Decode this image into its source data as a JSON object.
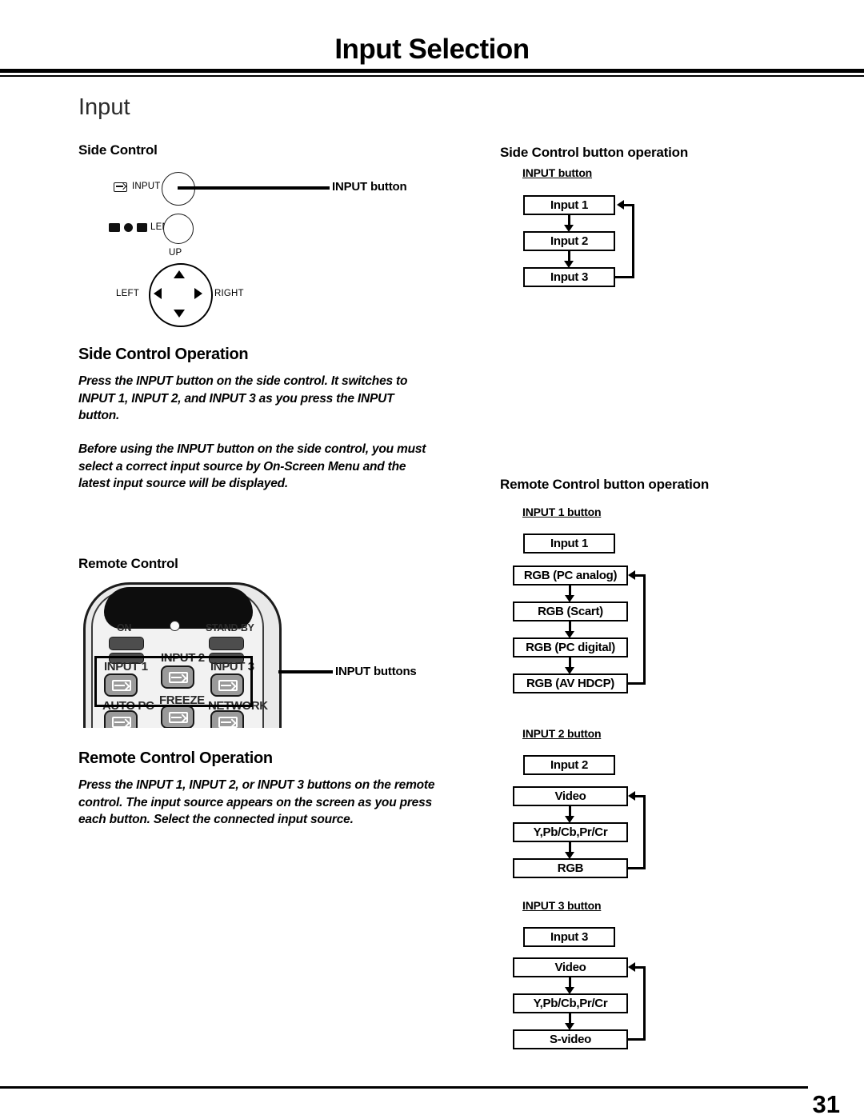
{
  "header": {
    "title": "Input Selection"
  },
  "section": {
    "heading": "Input"
  },
  "left_column": {
    "side_control_heading": "Side Control",
    "side_control_diagram": {
      "input_label": "INPUT",
      "lens_label": "LENS",
      "up_label": "UP",
      "left_label": "LEFT",
      "right_label": "RIGHT",
      "callout": "INPUT button"
    },
    "side_control_operation": {
      "heading": "Side Control Operation",
      "paragraph_1": "Press the INPUT button on the side control. It switches to INPUT 1, INPUT 2, and INPUT 3 as you press the INPUT button.",
      "paragraph_2": "Before using the INPUT button on the side control, you must select a correct input source by On-Screen Menu and the latest input source will be displayed."
    },
    "remote_control_heading": "Remote Control",
    "remote_diagram": {
      "on_label": "ON",
      "standby_label": "STAND-BY",
      "input1_label": "INPUT 1",
      "input2_label": "INPUT 2",
      "input3_label": "INPUT 3",
      "autopc_label": "AUTO PC",
      "freeze_label": "FREEZE",
      "network_label": "NETWORK",
      "callout": "INPUT buttons"
    },
    "remote_control_operation": {
      "heading": "Remote Control Operation",
      "paragraph_1": "Press the INPUT 1, INPUT 2, or INPUT 3 buttons on the remote control. The input source appears on the screen as you press each button. Select the connected input source."
    }
  },
  "right_column": {
    "side_control_button_operation": {
      "heading": "Side Control button operation",
      "sub_heading": "INPUT button",
      "boxes": [
        "Input 1",
        "Input 2",
        "Input 3"
      ]
    },
    "remote_control_button_operation": {
      "heading": "Remote Control button operation",
      "groups": [
        {
          "sub_heading": "INPUT 1 button",
          "head_box": "Input 1",
          "boxes": [
            "RGB (PC analog)",
            "RGB (Scart)",
            "RGB (PC digital)",
            "RGB (AV HDCP)"
          ]
        },
        {
          "sub_heading": "INPUT 2 button",
          "head_box": "Input 2",
          "boxes": [
            "Video",
            "Y,Pb/Cb,Pr/Cr",
            "RGB"
          ]
        },
        {
          "sub_heading": "INPUT 3 button",
          "head_box": "Input 3",
          "boxes": [
            "Video",
            "Y,Pb/Cb,Pr/Cr",
            "S-video"
          ]
        }
      ]
    }
  },
  "footer": {
    "page_number": "31"
  },
  "colors": {
    "ink": "#000000",
    "heading_gray": "#2b2b2b",
    "remote_body": "#e9e9e9",
    "remote_key": "#9a9a9a",
    "remote_dark": "#4d4d4d"
  }
}
